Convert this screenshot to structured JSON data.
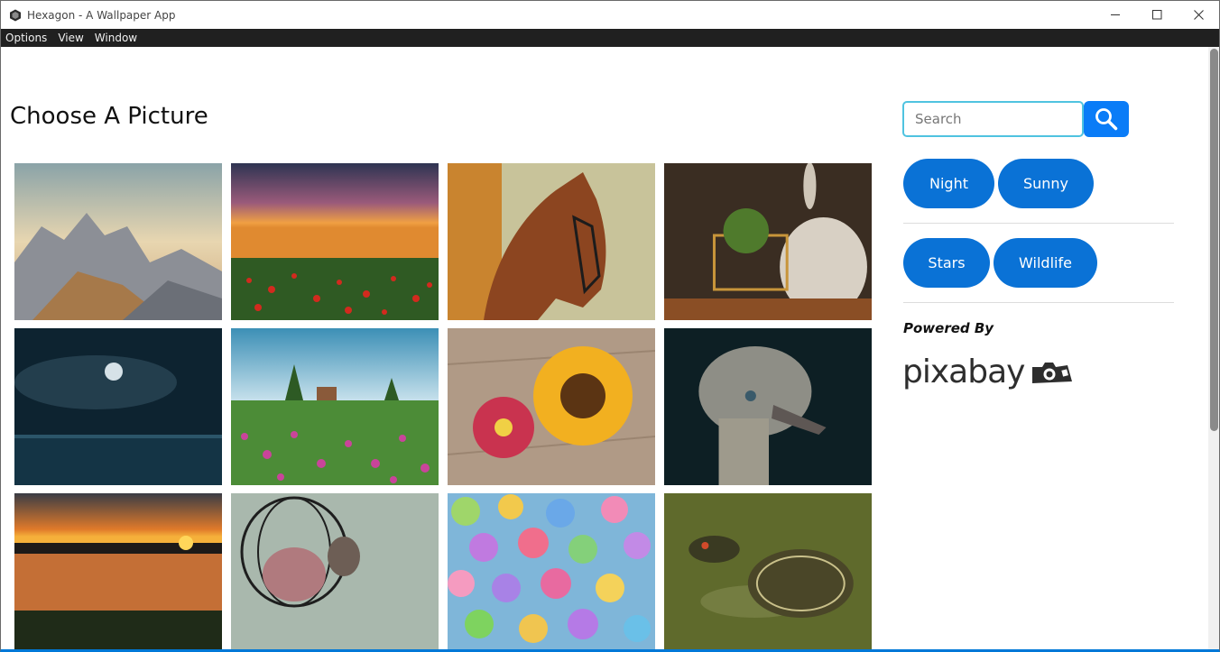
{
  "window": {
    "title": "Hexagon - A Wallpaper App",
    "controls": {
      "minimize": "—",
      "maximize": "☐",
      "close": "✕"
    }
  },
  "menu": [
    "Options",
    "View",
    "Window"
  ],
  "main": {
    "heading": "Choose A Picture",
    "images": [
      {
        "name": "mountain-peaks"
      },
      {
        "name": "poppy-field-sunset"
      },
      {
        "name": "brown-horse"
      },
      {
        "name": "rabbit-with-cart"
      },
      {
        "name": "moon-over-sea"
      },
      {
        "name": "flower-meadow-cabin"
      },
      {
        "name": "sunflower-and-dahlia"
      },
      {
        "name": "ostrich-head"
      },
      {
        "name": "lake-sunset"
      },
      {
        "name": "bird-on-feeder"
      },
      {
        "name": "colorful-hearts"
      },
      {
        "name": "turtle"
      }
    ]
  },
  "sidebar": {
    "search": {
      "placeholder": "Search",
      "value": ""
    },
    "search_button_icon": "search-icon",
    "tags_row1": [
      "Night",
      "Sunny"
    ],
    "tags_row2": [
      "Stars",
      "Wildlife"
    ],
    "powered_by": "Powered By",
    "brand": "pixabay",
    "brand_icon": "camera-icon"
  },
  "colors": {
    "accent": "#0a72d6",
    "search_button": "#0a7cf7",
    "menubar": "#202020",
    "input_border": "#4fc3e0"
  }
}
